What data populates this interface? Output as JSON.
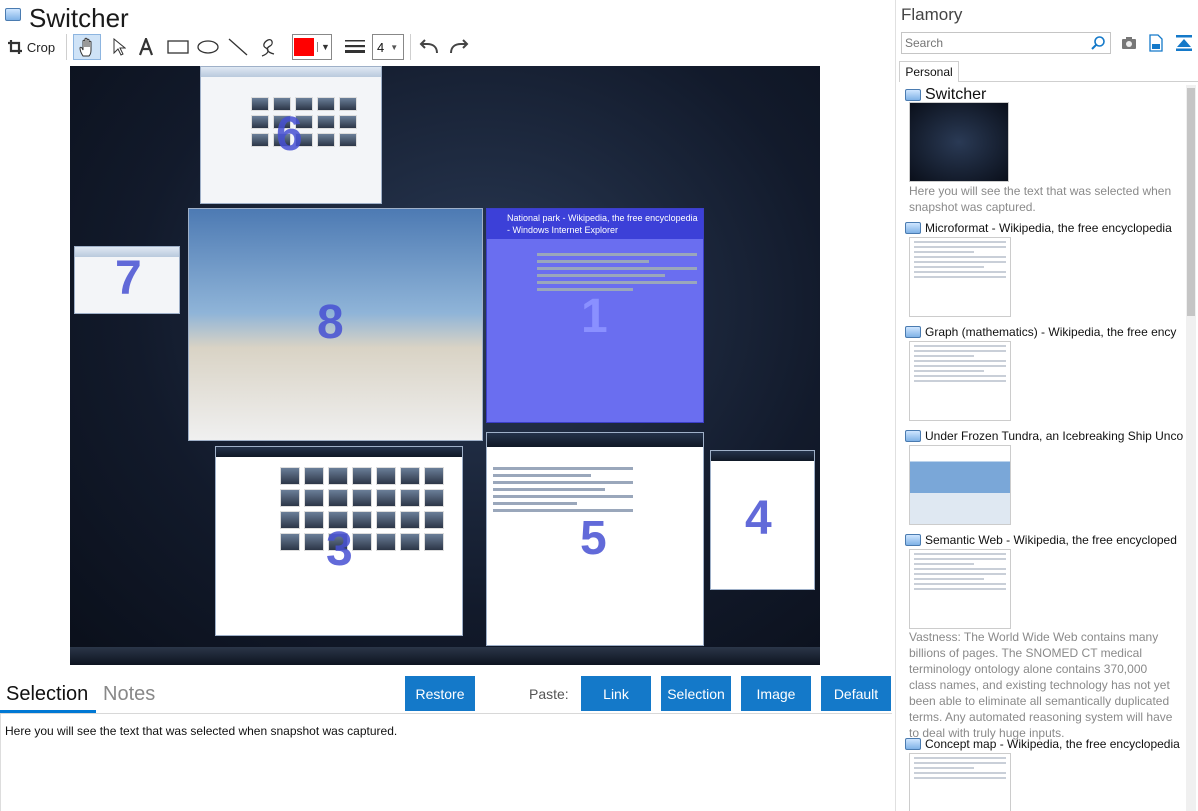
{
  "header": {
    "title": "Switcher"
  },
  "toolbar": {
    "crop_label": "Crop",
    "line_width": "4",
    "color": "#ff0000"
  },
  "canvas": {
    "windows": [
      {
        "number": "6"
      },
      {
        "number": "7"
      },
      {
        "number": "8"
      },
      {
        "number": "1",
        "title": "National park - Wikipedia, the free encyclopedia - Windows Internet Explorer"
      },
      {
        "number": "3"
      },
      {
        "number": "5"
      },
      {
        "number": "4"
      }
    ]
  },
  "bottom": {
    "tabs": [
      "Selection",
      "Notes"
    ],
    "restore_label": "Restore",
    "paste_label": "Paste:",
    "paste_buttons": [
      "Link",
      "Selection",
      "Image",
      "Default"
    ],
    "selection_text": "Here you will see the text that was selected when snapshot was captured."
  },
  "sidebar": {
    "app_name": "Flamory",
    "search_placeholder": "Search",
    "tab": "Personal",
    "items": [
      {
        "title": "Switcher",
        "desc": "Here you will see the text that was selected when snapshot was captured."
      },
      {
        "title": "Microformat - Wikipedia, the free encyclopedia"
      },
      {
        "title": "Graph (mathematics) - Wikipedia, the free ency"
      },
      {
        "title": "Under Frozen Tundra, an Icebreaking Ship Unco"
      },
      {
        "title": "Semantic Web - Wikipedia, the free encycloped",
        "desc": "Vastness: The World Wide Web contains many billions of pages. The SNOMED CT medical terminology ontology alone contains 370,000 class names, and existing technology has not yet been able to eliminate all semantically duplicated terms. Any automated reasoning system will have to deal with truly huge inputs."
      },
      {
        "title": "Concept map - Wikipedia, the free encyclopedia"
      }
    ]
  },
  "colors": {
    "accent": "#1479c9",
    "highlight": "#0078d4"
  }
}
